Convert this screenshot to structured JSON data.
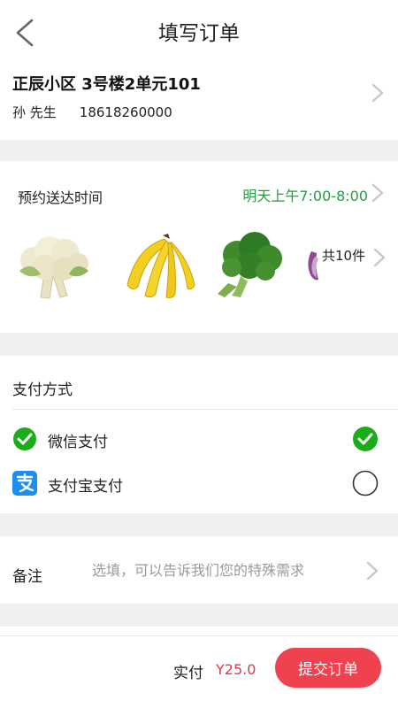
{
  "header": {
    "title": "填写订单"
  },
  "address": {
    "line": "正辰小区 3号楼2单元101",
    "name": "孙 先生",
    "phone": "18618260000"
  },
  "delivery": {
    "label": "预约送达时间",
    "time": "明天上午7:00-8:00",
    "products": [
      {
        "name": "cauliflower"
      },
      {
        "name": "banana"
      },
      {
        "name": "broccoli"
      },
      {
        "name": "purple-cabbage"
      }
    ],
    "count_label": "共10件"
  },
  "payment": {
    "title": "支付方式",
    "options": [
      {
        "label": "微信支付",
        "selected": true,
        "icon": "wechat-pay-icon",
        "color": "#1aad19"
      },
      {
        "label": "支付宝支付",
        "selected": false,
        "icon": "alipay-icon",
        "color": "#1a8ff0"
      }
    ]
  },
  "remark": {
    "label": "备注",
    "placeholder": "选填，可以告诉我们您的特殊需求"
  },
  "footer": {
    "amount_label": "实付",
    "amount": "Y25.0",
    "submit_label": "提交订单"
  },
  "colors": {
    "accent": "#f0414f",
    "green": "#2a9a45",
    "price": "#e8334a"
  }
}
